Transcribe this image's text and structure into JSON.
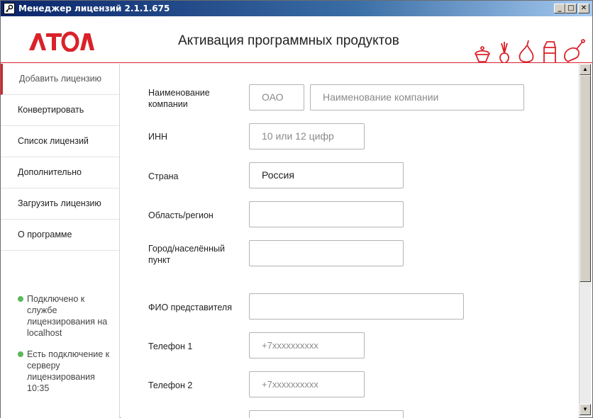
{
  "window": {
    "title": "Менеджер лицензий 2.1.1.675",
    "minimize": "_",
    "maximize": "□",
    "close": "✕"
  },
  "header": {
    "logo": "АТОЛ",
    "title": "Активация программных продуктов",
    "accent_color": "#d9222a"
  },
  "sidebar": {
    "items": [
      {
        "label": "Добавить лицензию",
        "active": true
      },
      {
        "label": "Конвертировать"
      },
      {
        "label": "Список лицензий"
      },
      {
        "label": "Дополнительно"
      },
      {
        "label": "Загрузить лицензию"
      },
      {
        "label": "О программе"
      }
    ],
    "status": [
      {
        "text": "Подключено к службе лицензирования на localhost",
        "color": "#5cb85c"
      },
      {
        "text": "Есть подключение к серверу лицензирования 10:35",
        "color": "#5cb85c"
      }
    ]
  },
  "form": {
    "company": {
      "label": "Наименование компании",
      "type_placeholder": "ОАО",
      "name_placeholder": "Наименование компании"
    },
    "inn": {
      "label": "ИНН",
      "placeholder": "10 или 12 цифр"
    },
    "country": {
      "label": "Страна",
      "value": "Россия"
    },
    "region": {
      "label": "Область/регион",
      "value": ""
    },
    "city": {
      "label": "Город/населённый пункт",
      "value": ""
    },
    "representative": {
      "label": "ФИО представителя",
      "value": ""
    },
    "phone1": {
      "label": "Телефон 1",
      "placeholder": "+7xxxxxxxxxx"
    },
    "phone2": {
      "label": "Телефон 2",
      "placeholder": "+7xxxxxxxxxx"
    }
  }
}
